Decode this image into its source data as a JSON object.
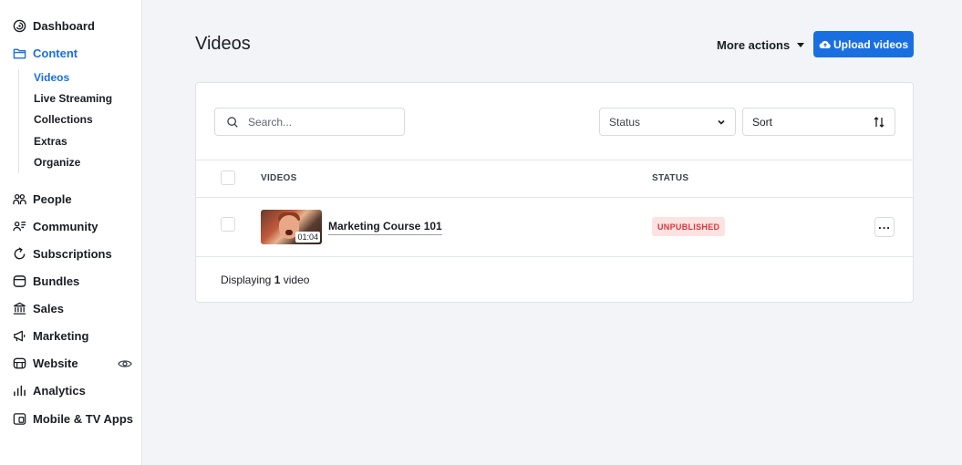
{
  "sidebar": {
    "items": [
      {
        "label": "Dashboard",
        "icon": "dashboard-icon"
      },
      {
        "label": "Content",
        "icon": "folder-icon"
      },
      {
        "label": "People",
        "icon": "people-icon"
      },
      {
        "label": "Community",
        "icon": "community-icon"
      },
      {
        "label": "Subscriptions",
        "icon": "subscriptions-icon"
      },
      {
        "label": "Bundles",
        "icon": "bundles-icon"
      },
      {
        "label": "Sales",
        "icon": "bank-icon"
      },
      {
        "label": "Marketing",
        "icon": "megaphone-icon"
      },
      {
        "label": "Website",
        "icon": "website-icon"
      },
      {
        "label": "Analytics",
        "icon": "bar-chart-icon"
      },
      {
        "label": "Mobile & TV Apps",
        "icon": "devices-icon"
      }
    ],
    "sub_items": [
      "Videos",
      "Live Streaming",
      "Collections",
      "Extras",
      "Organize"
    ],
    "active_item": "Content",
    "active_sub_item": "Videos"
  },
  "header": {
    "title": "Videos",
    "more_actions_label": "More actions",
    "upload_label": "Upload videos"
  },
  "toolbar": {
    "search_placeholder": "Search...",
    "status_label": "Status",
    "sort_label": "Sort"
  },
  "table": {
    "columns": [
      "VIDEOS",
      "STATUS"
    ],
    "rows": [
      {
        "title": "Marketing Course 101",
        "duration": "01:04",
        "status": "UNPUBLISHED"
      }
    ],
    "footer_prefix": "Displaying",
    "footer_count": "1",
    "footer_suffix": "video"
  },
  "colors": {
    "accent": "#1a6fe0",
    "badge_bg": "#fde2e2",
    "badge_text": "#d9363e",
    "page_bg": "#f2f4f7"
  }
}
